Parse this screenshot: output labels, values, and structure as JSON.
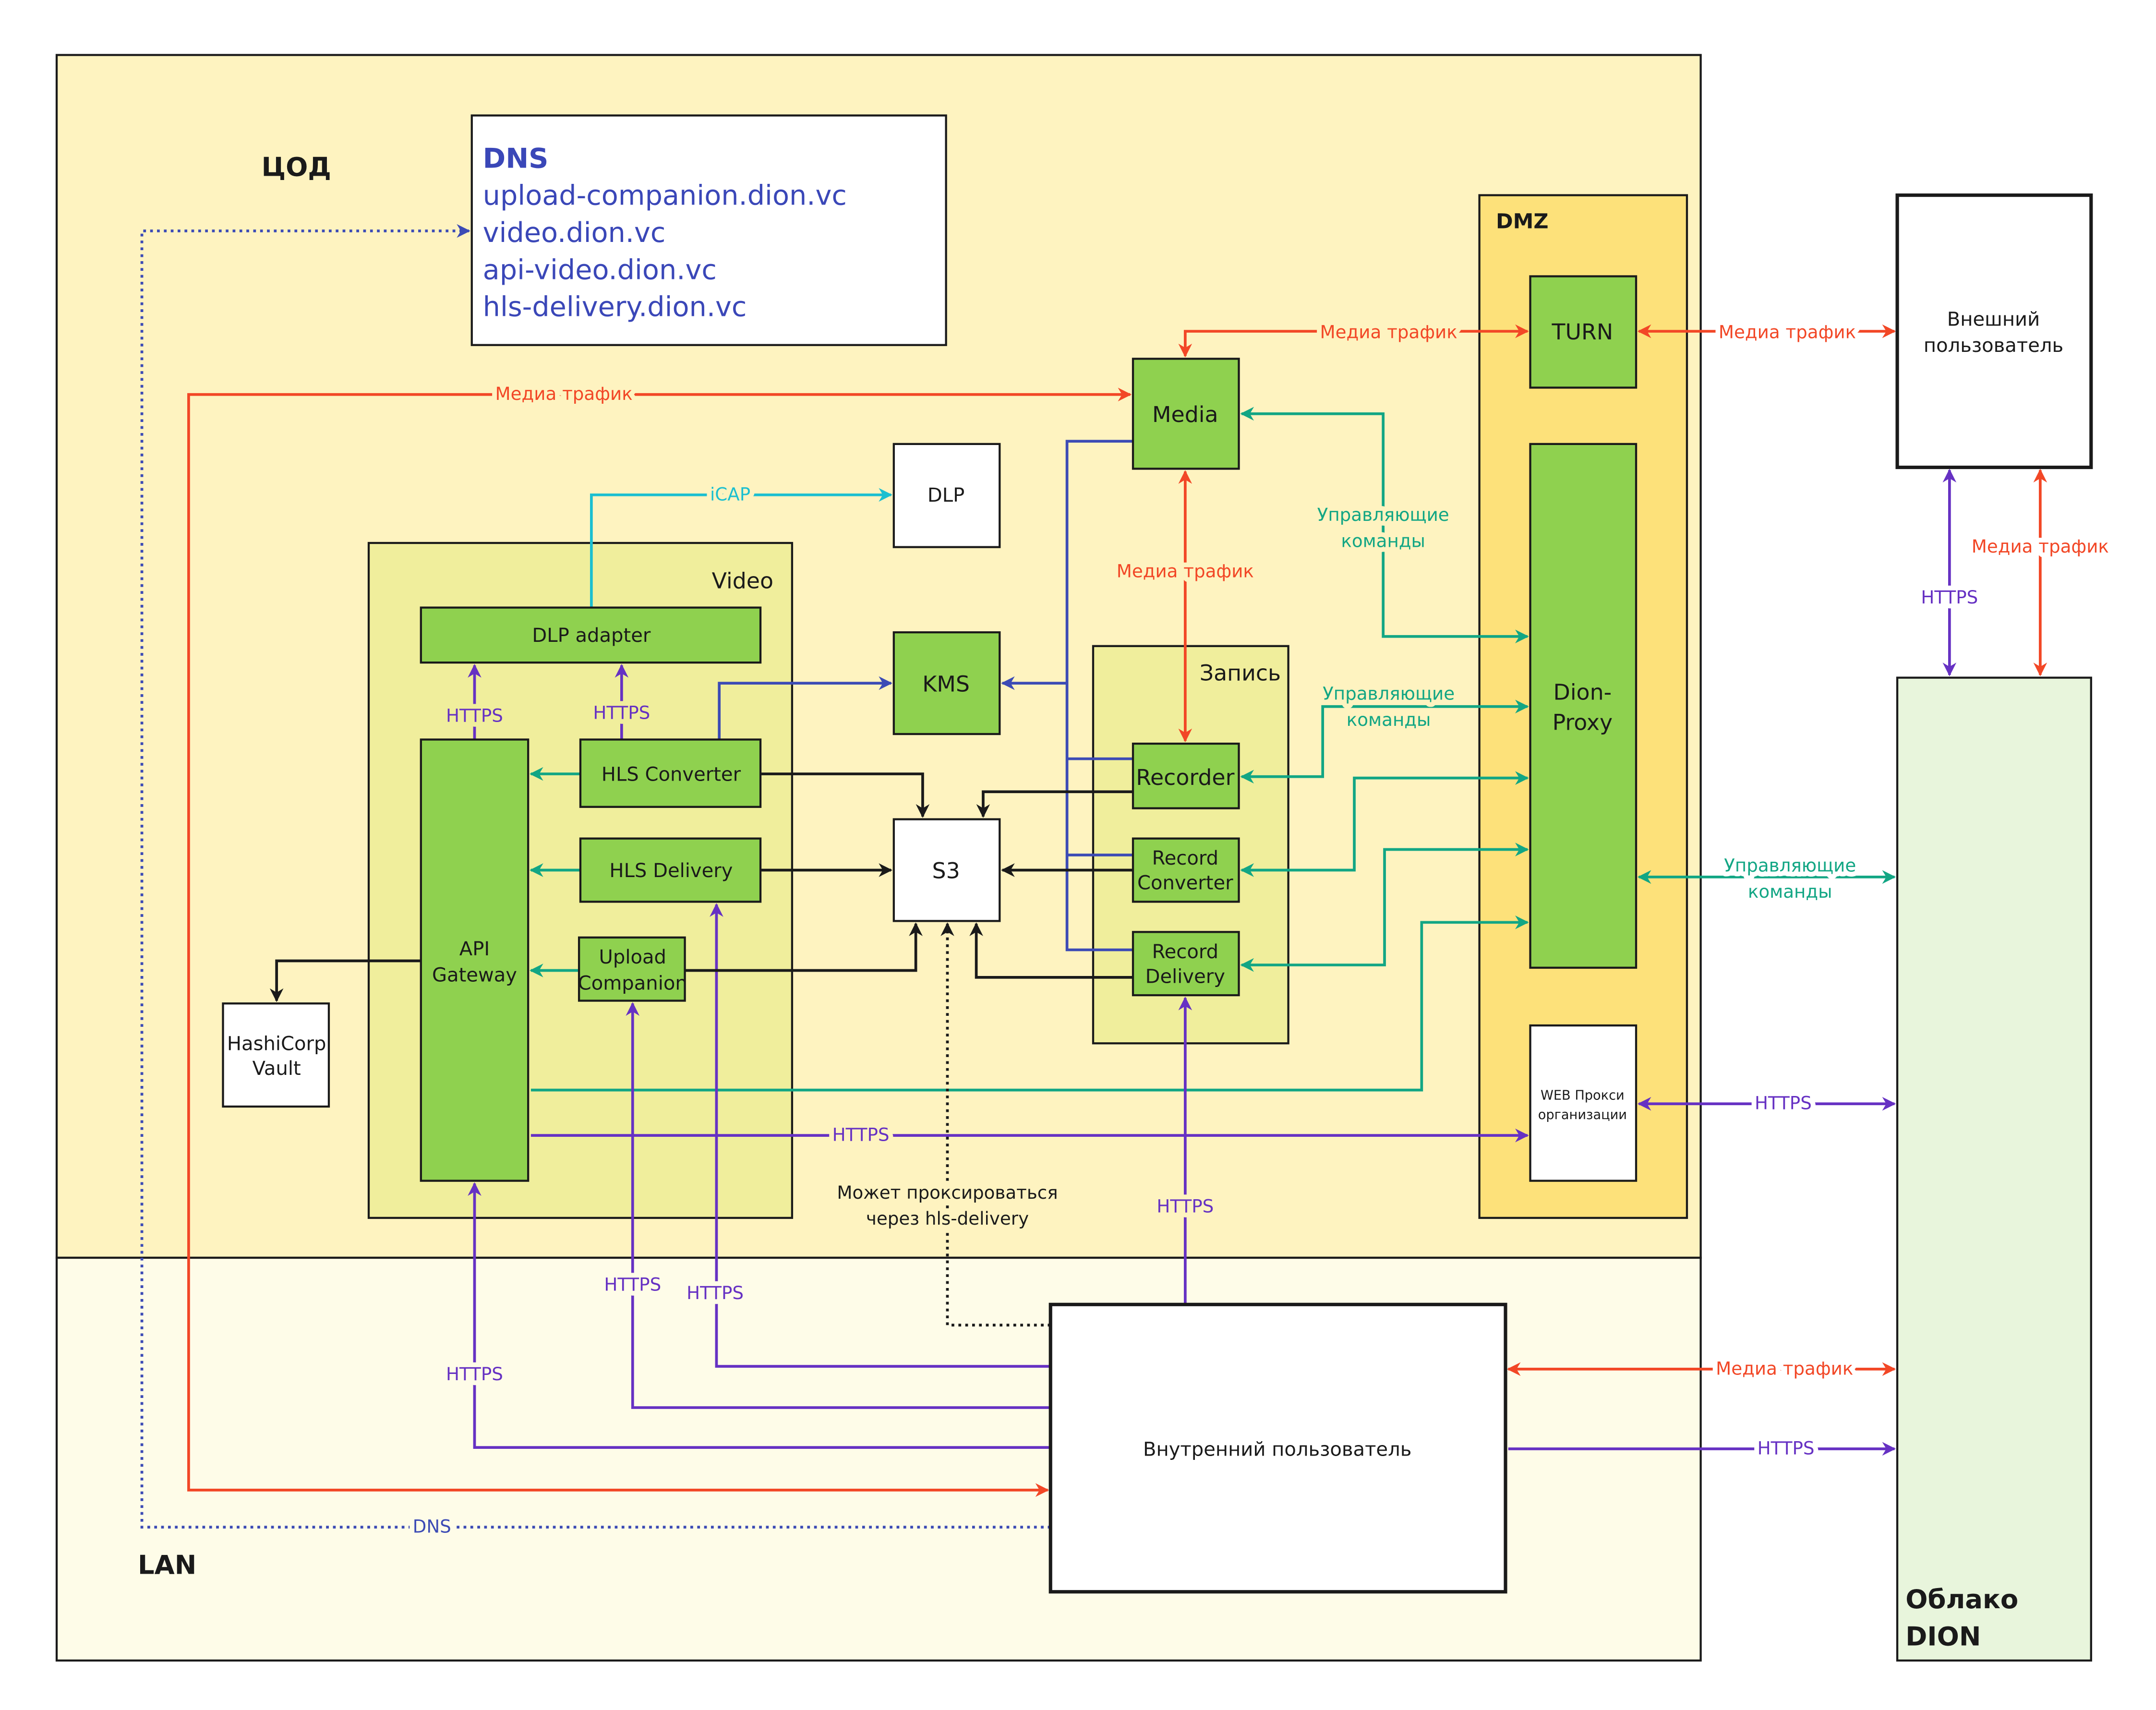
{
  "zones": {
    "cod": "ЦОД",
    "lan": "LAN",
    "dmz": "DMZ",
    "video": "Video",
    "record": "Запись",
    "cloud": [
      "Облако",
      "DION"
    ]
  },
  "dns": {
    "title": "DNS",
    "entries": [
      "upload-companion.dion.vc",
      "video.dion.vc",
      "api-video.dion.vc",
      "hls-delivery.dion.vc"
    ]
  },
  "nodes": {
    "turn": "TURN",
    "dion_proxy": [
      "Dion-",
      "Proxy"
    ],
    "web_proxy": [
      "WEB Прокси",
      "организации"
    ],
    "external_user": [
      "Внешний",
      "пользователь"
    ],
    "media": "Media",
    "dlp": "DLP",
    "kms": "KMS",
    "s3": "S3",
    "recorder": "Recorder",
    "record_converter": [
      "Record",
      "Converter"
    ],
    "record_delivery": [
      "Record",
      "Delivery"
    ],
    "dlp_adapter": "DLP adapter",
    "api_gateway": [
      "API",
      "Gateway"
    ],
    "hls_converter": "HLS Converter",
    "hls_delivery": "HLS Delivery",
    "upload_companion": [
      "Upload",
      "Companion"
    ],
    "vault": [
      "HashiCorp",
      "Vault"
    ],
    "internal_user": "Внутренний пользователь"
  },
  "edge_labels": {
    "media_traffic": "Медиа трафик",
    "control": [
      "Управляющие",
      "команды"
    ],
    "https": "HTTPS",
    "icap": "iCAP",
    "dns": "DNS",
    "proxy_note": [
      "Может проксироваться",
      "через hls-delivery"
    ]
  },
  "colors": {
    "media": "#f24726",
    "control": "#12a684",
    "https": "#6631c3",
    "kms": "#3c4bb5",
    "icap": "#1bbfd0",
    "storage": "#1a1a1a",
    "cod_bg": "#fef3c0",
    "lan_bg": "#fefce8",
    "dmz_bg": "#fde17a",
    "service": "#8fd14f",
    "cloud_bg": "#e8f5dc"
  }
}
